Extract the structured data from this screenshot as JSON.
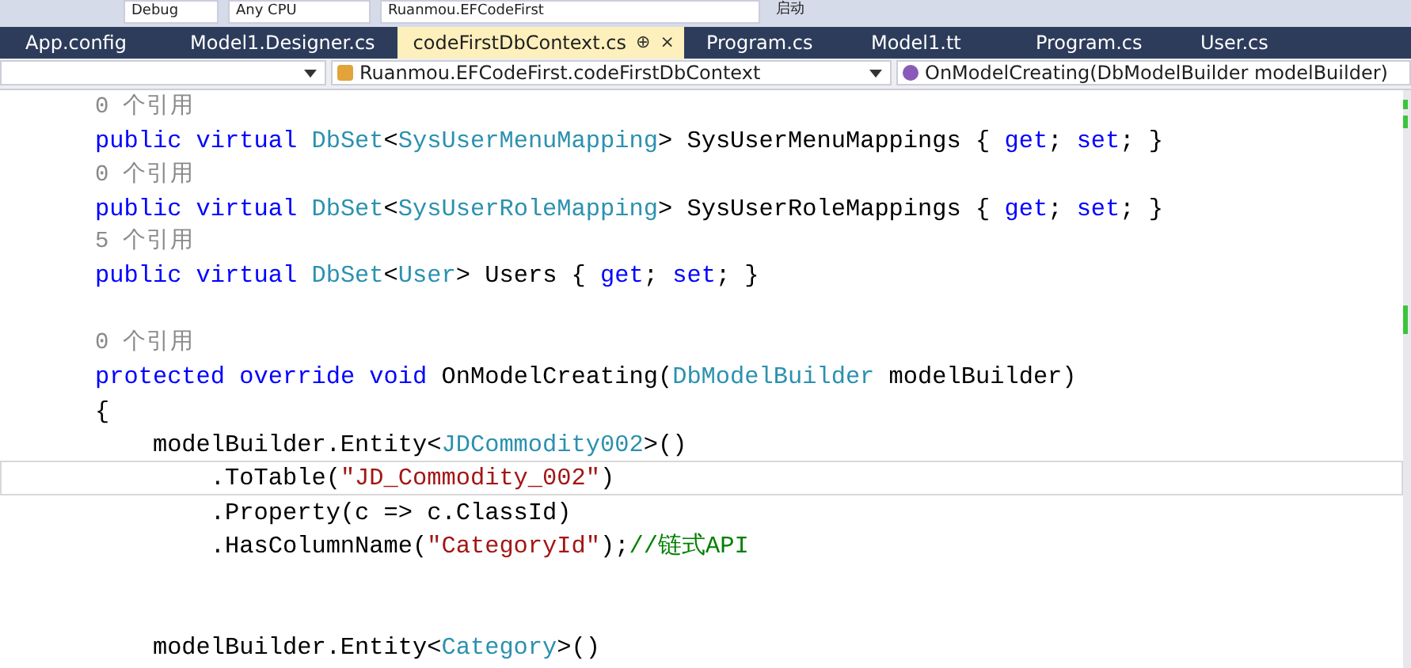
{
  "toolbar": {
    "items": [
      "Debug",
      "Any CPU",
      "Ruanmou.EFCodeFirst",
      "启动"
    ]
  },
  "tabs": [
    {
      "label": "App.config",
      "selected": false
    },
    {
      "label": "Model1.Designer.cs",
      "selected": false
    },
    {
      "label": "codeFirstDbContext.cs",
      "selected": true,
      "pin": "⊕",
      "close": "×"
    },
    {
      "label": "Program.cs",
      "selected": false
    },
    {
      "label": "Model1.tt",
      "selected": false
    },
    {
      "label": "Program.cs",
      "selected": false
    },
    {
      "label": "User.cs",
      "selected": false
    }
  ],
  "navigation_bar": {
    "class": "Ruanmou.EFCodeFirst.codeFirstDbContext",
    "member": "OnModelCreating(DbModelBuilder modelBuilder)"
  },
  "code_lines": [
    {
      "current": false,
      "tokens": [
        {
          "kind": "lens",
          "text": "0 个引用"
        }
      ]
    },
    {
      "current": false,
      "tokens": [
        {
          "kind": "keyword",
          "text": "public virtual "
        },
        {
          "kind": "type",
          "text": "DbSet"
        },
        {
          "kind": "plain",
          "text": "<"
        },
        {
          "kind": "type",
          "text": "SysUserMenuMapping"
        },
        {
          "kind": "plain",
          "text": "> SysUserMenuMappings { "
        },
        {
          "kind": "keyword",
          "text": "get"
        },
        {
          "kind": "plain",
          "text": "; "
        },
        {
          "kind": "keyword",
          "text": "set"
        },
        {
          "kind": "plain",
          "text": "; }"
        }
      ]
    },
    {
      "current": false,
      "tokens": [
        {
          "kind": "lens",
          "text": "0 个引用"
        }
      ]
    },
    {
      "current": false,
      "tokens": [
        {
          "kind": "keyword",
          "text": "public virtual "
        },
        {
          "kind": "type",
          "text": "DbSet"
        },
        {
          "kind": "plain",
          "text": "<"
        },
        {
          "kind": "type",
          "text": "SysUserRoleMapping"
        },
        {
          "kind": "plain",
          "text": "> SysUserRoleMappings { "
        },
        {
          "kind": "keyword",
          "text": "get"
        },
        {
          "kind": "plain",
          "text": "; "
        },
        {
          "kind": "keyword",
          "text": "set"
        },
        {
          "kind": "plain",
          "text": "; }"
        }
      ]
    },
    {
      "current": false,
      "tokens": [
        {
          "kind": "lens",
          "text": "5 个引用"
        }
      ]
    },
    {
      "current": false,
      "tokens": [
        {
          "kind": "keyword",
          "text": "public virtual "
        },
        {
          "kind": "type",
          "text": "DbSet"
        },
        {
          "kind": "plain",
          "text": "<"
        },
        {
          "kind": "type",
          "text": "User"
        },
        {
          "kind": "plain",
          "text": "> Users { "
        },
        {
          "kind": "keyword",
          "text": "get"
        },
        {
          "kind": "plain",
          "text": "; "
        },
        {
          "kind": "keyword",
          "text": "set"
        },
        {
          "kind": "plain",
          "text": "; }"
        }
      ]
    },
    {
      "current": false
    },
    {
      "current": false,
      "tokens": [
        {
          "kind": "lens",
          "text": "0 个引用"
        }
      ]
    },
    {
      "current": false,
      "tokens": [
        {
          "kind": "keyword",
          "text": "protected override void "
        },
        {
          "kind": "plain",
          "text": "OnModelCreating("
        },
        {
          "kind": "type",
          "text": "DbModelBuilder"
        },
        {
          "kind": "plain",
          "text": " modelBuilder)"
        }
      ]
    },
    {
      "current": false,
      "tokens": [
        {
          "kind": "plain",
          "text": "{"
        }
      ],
      "children": [
        {
          "current": false,
          "tokens": [
            {
              "kind": "plain",
              "text": "modelBuilder.Entity<"
            },
            {
              "kind": "type",
              "text": "JDCommodity002"
            },
            {
              "kind": "plain",
              "text": ">()"
            }
          ],
          "children": [
            {
              "current": true,
              "tokens": [
                {
                  "kind": "plain",
                  "text": ".ToTable("
                },
                {
                  "kind": "string",
                  "text": "\"JD_Commodity_002\""
                },
                {
                  "kind": "plain",
                  "text": ")"
                }
              ]
            },
            {
              "current": false,
              "tokens": [
                {
                  "kind": "plain",
                  "text": ".Property(c => c.ClassId)"
                }
              ]
            },
            {
              "current": false,
              "tokens": [
                {
                  "kind": "plain",
                  "text": ".HasColumnName("
                },
                {
                  "kind": "string",
                  "text": "\"CategoryId\""
                },
                {
                  "kind": "plain",
                  "text": ");"
                },
                {
                  "kind": "comment",
                  "text": "//链式API"
                }
              ]
            }
          ]
        },
        {
          "current": false
        },
        {
          "current": false
        },
        {
          "current": false,
          "tokens": [
            {
              "kind": "plain",
              "text": "modelBuilder.Entity<"
            },
            {
              "kind": "type",
              "text": "Category"
            },
            {
              "kind": "plain",
              "text": ">()"
            }
          ]
        }
      ]
    }
  ]
}
